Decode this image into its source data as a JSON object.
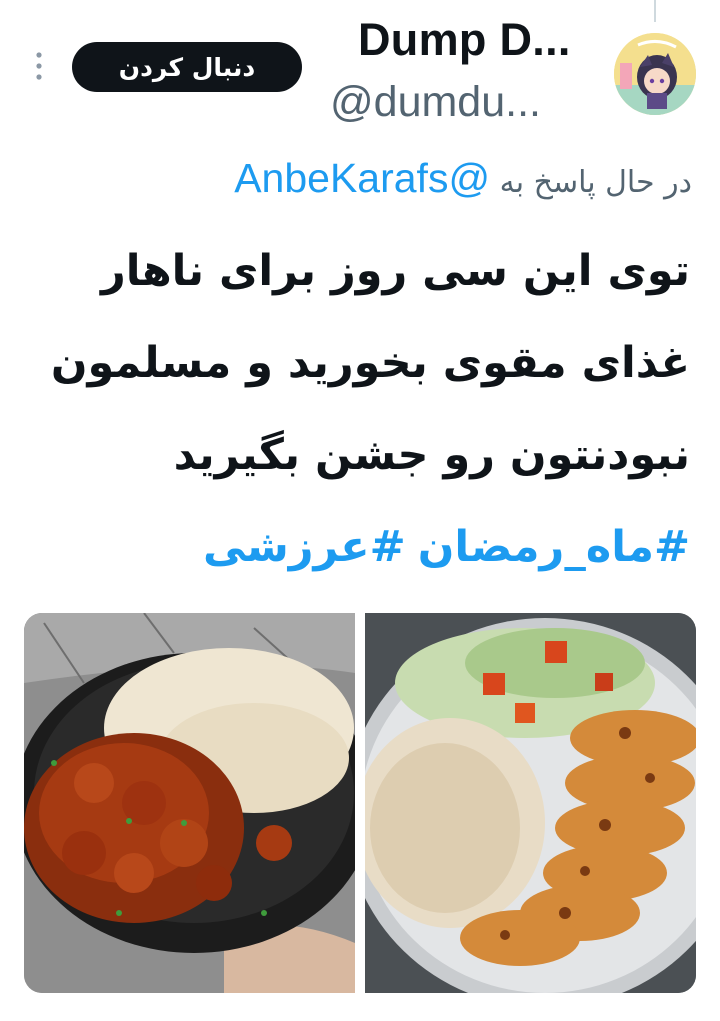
{
  "author": {
    "display_name": "Dump D...",
    "handle": "@dumdu..."
  },
  "header": {
    "follow_label": "دنبال کردن"
  },
  "reply_context": {
    "prefix": "در حال پاسخ به",
    "mention": "@AnbeKarafs"
  },
  "tweet": {
    "lines": [
      "توی این سی روز برای ناهار",
      "غذای مقوی بخورید و مسلمون",
      "نبودنتون رو جشن بگیرید"
    ],
    "hashtags": [
      "#ماه_رمضان",
      "#عرزشی"
    ]
  },
  "icons": {
    "avatar": "anime-avatar-icon",
    "more": "more-vertical-icon"
  },
  "colors": {
    "link": "#1d9bf0",
    "text": "#0f1419",
    "secondary": "#536471",
    "button": "#0f1419"
  }
}
